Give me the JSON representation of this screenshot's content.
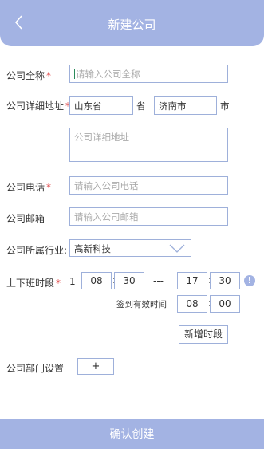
{
  "header": {
    "title": "新建公司",
    "back_icon": "chevron-left-icon"
  },
  "form": {
    "name": {
      "label": "公司全称",
      "required_mark": "*",
      "placeholder": "请输入公司全称"
    },
    "address": {
      "label": "公司详细地址",
      "required_mark": "*",
      "province_value": "山东省",
      "province_unit": "省",
      "city_value": "济南市",
      "city_unit": "市",
      "detail_placeholder": "公司详细地址"
    },
    "phone": {
      "label": "公司电话",
      "required_mark": "*",
      "placeholder": "请输入公司电话"
    },
    "email": {
      "label": "公司邮箱",
      "placeholder": "请输入公司邮箱"
    },
    "industry": {
      "label": "公司所属行业:",
      "value": "高新科技",
      "icon": "chevron-down-icon"
    },
    "work_hours": {
      "label": "上下班时段",
      "required_mark": "*",
      "index": "1-",
      "start_hour": "08",
      "start_minute": "30",
      "range_separator": "---",
      "end_hour": "17",
      "end_minute": "30",
      "time_separator": ":",
      "info_icon": "!",
      "checkin_label": "签到有效时间",
      "checkin_hour": "08",
      "checkin_minute": "00",
      "add_button": "新增时段"
    },
    "departments": {
      "label": "公司部门设置",
      "add_button": "+"
    }
  },
  "footer": {
    "submit_label": "确认创建"
  }
}
